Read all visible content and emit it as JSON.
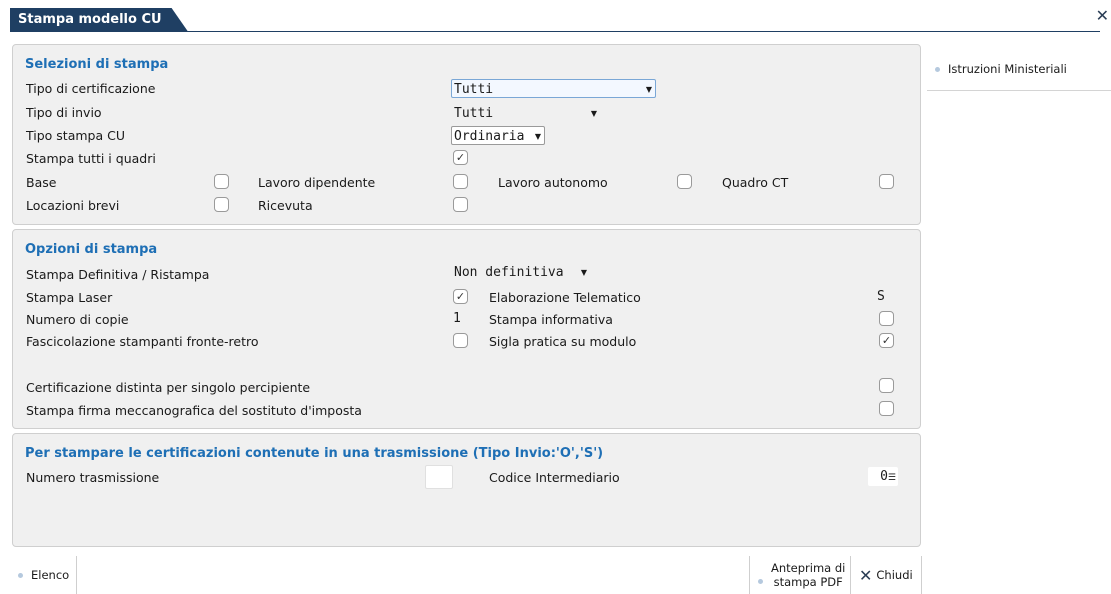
{
  "window": {
    "title": "Stampa modello CU"
  },
  "sel": {
    "title": "Selezioni di stampa",
    "tipo_cert_label": "Tipo di certificazione",
    "tipo_cert_value": "Tutti",
    "tipo_invio_label": "Tipo di invio",
    "tipo_invio_value": "Tutti",
    "tipo_stampa_label": "Tipo stampa CU",
    "tipo_stampa_value": "Ordinaria",
    "stampa_tutti_label": "Stampa tutti i quadri",
    "base_label": "Base",
    "lavoro_dip_label": "Lavoro dipendente",
    "lavoro_aut_label": "Lavoro autonomo",
    "quadro_ct_label": "Quadro CT",
    "locazioni_label": "Locazioni brevi",
    "ricevuta_label": "Ricevuta"
  },
  "opt": {
    "title": "Opzioni di stampa",
    "definitiva_label": "Stampa Definitiva / Ristampa",
    "definitiva_value": "Non definitiva",
    "laser_label": "Stampa Laser",
    "telematico_label": "Elaborazione Telematico",
    "telematico_value": "S",
    "copie_label": "Numero di copie",
    "copie_value": "1",
    "informativa_label": "Stampa informativa",
    "fascicolazione_label": "Fascicolazione stampanti fronte-retro",
    "sigla_label": "Sigla pratica su modulo",
    "distinta_label": "Certificazione distinta per singolo percipiente",
    "firma_label": "Stampa firma meccanografica del sostituto d'imposta"
  },
  "trasm": {
    "title": "Per stampare le certificazioni contenute in una trasmissione (Tipo Invio:'O','S')",
    "numero_label": "Numero trasmissione",
    "codice_label": "Codice Intermediario",
    "codice_value": "0"
  },
  "side": {
    "istruzioni": "Istruzioni Ministeriali"
  },
  "bottom": {
    "elenco": "Elenco",
    "anteprima_line1": "Anteprima di",
    "anteprima_line2": "stampa PDF",
    "chiudi": "Chiudi"
  },
  "checks": {
    "stampa_tutti": true,
    "base": false,
    "lavoro_dip": false,
    "lavoro_aut": false,
    "quadro_ct": false,
    "locazioni": false,
    "ricevuta": false,
    "laser": true,
    "informativa": false,
    "fascicolazione": false,
    "sigla": true,
    "distinta": false,
    "firma": false
  }
}
